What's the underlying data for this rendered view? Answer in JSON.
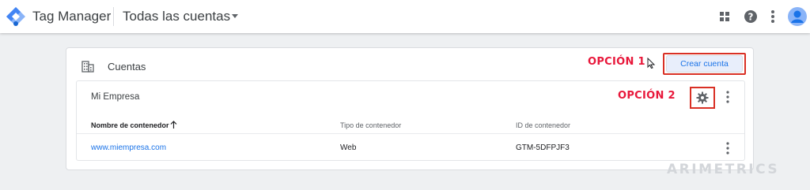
{
  "header": {
    "app_title": "Tag Manager",
    "account_selector": "Todas las cuentas",
    "icons": [
      "apps-grid-icon",
      "help-icon",
      "more-vert-icon",
      "avatar"
    ]
  },
  "accounts_card": {
    "title": "Cuentas",
    "create_button": "Crear cuenta",
    "annotation_1": "OPCIÓN 1",
    "annotation_2": "OPCIÓN 2",
    "account": {
      "name": "Mi Empresa",
      "columns": [
        "Nombre de contenedor",
        "Tipo de contenedor",
        "ID de contenedor"
      ],
      "rows": [
        {
          "name": "www.miempresa.com",
          "type": "Web",
          "id": "GTM-5DFPJF3"
        }
      ]
    }
  },
  "watermark": "ARIMETRICS",
  "colors": {
    "accent_blue": "#1a73e8",
    "highlight_red": "#d93025",
    "annotation_red": "#e8173a"
  }
}
